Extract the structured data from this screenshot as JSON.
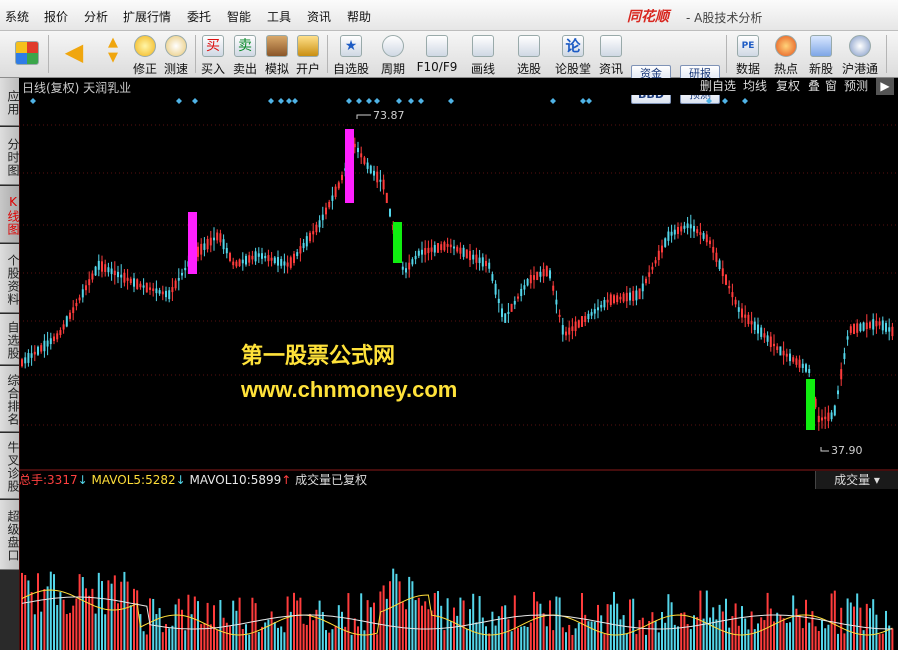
{
  "menu": {
    "items": [
      "系统",
      "报价",
      "分析",
      "扩展行情",
      "委托",
      "智能",
      "工具",
      "资讯",
      "帮助"
    ],
    "brand": "同花顺",
    "subtitle": "- A股技术分析"
  },
  "toolbar": {
    "items": [
      {
        "label": "",
        "icon": "windows-grid-icon"
      },
      {
        "label": "",
        "icon": "back-arrow-icon"
      },
      {
        "label": "",
        "icon": "up-down-arrow-icon"
      },
      {
        "label": "修正",
        "icon": "refresh-icon"
      },
      {
        "label": "测速",
        "icon": "clock-icon"
      },
      {
        "label": "买入",
        "icon": "buy-icon"
      },
      {
        "label": "卖出",
        "icon": "sell-icon"
      },
      {
        "label": "模拟",
        "icon": "hammer-icon"
      },
      {
        "label": "开户",
        "icon": "lock-icon"
      },
      {
        "label": "自选股",
        "icon": "star-icon"
      },
      {
        "label": "周期",
        "icon": "cycle-icon"
      },
      {
        "label": "F10/F9",
        "icon": "f10-icon"
      },
      {
        "label": "画线",
        "icon": "pen-icon"
      },
      {
        "label": "选股",
        "icon": "chart-icon"
      },
      {
        "label": "论股堂",
        "icon": "forum-icon"
      },
      {
        "label": "资讯",
        "icon": "news-icon"
      },
      {
        "label": "数据",
        "icon": "pe-icon"
      },
      {
        "label": "热点",
        "icon": "fire-icon"
      },
      {
        "label": "新股",
        "icon": "ipo-icon"
      },
      {
        "label": "沪港通",
        "icon": "hk-icon"
      }
    ],
    "small_buttons": [
      "资金",
      "研报",
      "BBD",
      "预测"
    ]
  },
  "sidebar": {
    "items": [
      "应用",
      "分时图",
      "K线图",
      "个股资料",
      "自选股",
      "综合排名",
      "牛叉诊股",
      "超级盘口"
    ],
    "active": 2
  },
  "info": {
    "stock": "日线(复权) 天润乳业",
    "tabs": [
      "删自选",
      "均线",
      "复权",
      "叠",
      "窗",
      "预测"
    ]
  },
  "price": {
    "high_label": "73.87",
    "low_label": "37.90"
  },
  "watermark": {
    "line1": "第一股票公式网",
    "line2": "www.chnmoney.com"
  },
  "volume": {
    "total_label": "总手:",
    "total_value": "3317",
    "mavol5_label": "MAVOL5:",
    "mavol5_value": "5282",
    "mavol10_label": "MAVOL10:",
    "mavol10_value": "5899",
    "note": "成交量已复权",
    "selector": "成交量"
  },
  "colors": {
    "up": "#ff3c3c",
    "down": "#54d6ea",
    "magenta": "#ff20ff",
    "green": "#10ee10",
    "marker": "#4fb3e6"
  }
}
